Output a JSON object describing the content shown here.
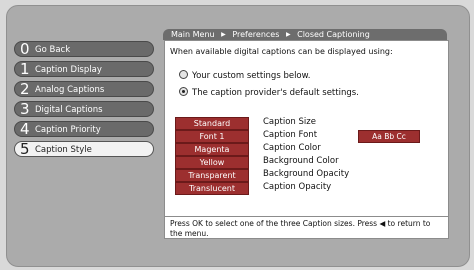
{
  "breadcrumb": {
    "items": [
      "Main Menu",
      "Preferences",
      "Closed Captioning"
    ],
    "separator": "▶"
  },
  "menu": {
    "items": [
      {
        "num": "0",
        "label": "Go Back",
        "active": false
      },
      {
        "num": "1",
        "label": "Caption Display",
        "active": false
      },
      {
        "num": "2",
        "label": "Analog Captions",
        "active": false
      },
      {
        "num": "3",
        "label": "Digital Captions",
        "active": false
      },
      {
        "num": "4",
        "label": "Caption Priority",
        "active": false
      },
      {
        "num": "5",
        "label": "Caption Style",
        "active": true
      }
    ]
  },
  "panel": {
    "intro": "When available digital captions can be displayed using:",
    "options": [
      {
        "label": "Your custom settings below.",
        "selected": false
      },
      {
        "label": "The caption provider's default settings.",
        "selected": true
      }
    ],
    "settings": [
      {
        "value": "Standard",
        "label": "Caption Size"
      },
      {
        "value": "Font 1",
        "label": "Caption Font"
      },
      {
        "value": "Magenta",
        "label": "Caption Color"
      },
      {
        "value": "Yellow",
        "label": "Background Color"
      },
      {
        "value": "Transparent",
        "label": "Background Opacity"
      },
      {
        "value": "Translucent",
        "label": "Caption Opacity"
      }
    ],
    "sample_text": "Aa Bb Cc",
    "footer": "Press OK to select one of the three Caption sizes. Press ◀ to return to the menu."
  },
  "colors": {
    "button_red": "#9c2f2f",
    "menu_dark": "#6a6a6a",
    "panel_bg": "#ffffff"
  }
}
